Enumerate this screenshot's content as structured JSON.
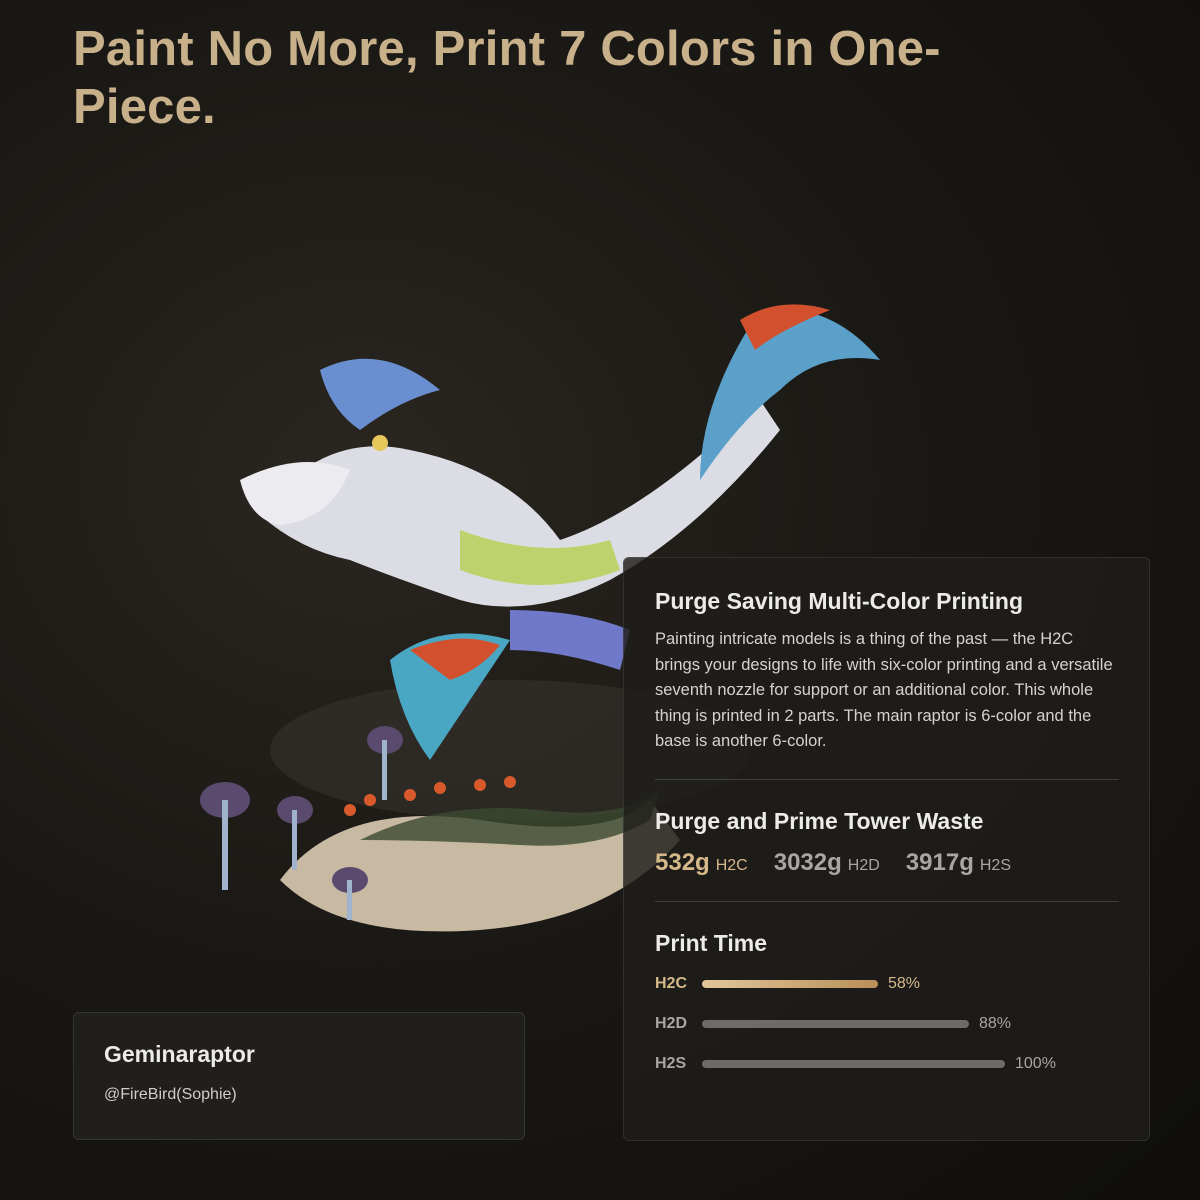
{
  "headline": "Paint No More, Print 7 Colors in One-Piece.",
  "model_card": {
    "name": "Geminaraptor",
    "credit": "@FireBird(Sophie)"
  },
  "info_card": {
    "title": "Purge Saving Multi-Color Printing",
    "body": "Painting intricate models is a thing of the past — the H2C brings your designs to life with six-color printing and a versatile seventh nozzle for support or an additional color. This whole thing is printed in 2 parts. The main raptor is 6-color and the base is another 6-color.",
    "waste": {
      "title": "Purge and Prime Tower Waste",
      "items": [
        {
          "value": "532g",
          "model": "H2C"
        },
        {
          "value": "3032g",
          "model": "H2D"
        },
        {
          "value": "3917g",
          "model": "H2S"
        }
      ]
    },
    "print_time": {
      "title": "Print Time",
      "bars": [
        {
          "model": "H2C",
          "label": "58%",
          "fraction": 0.58
        },
        {
          "model": "H2D",
          "label": "88%",
          "fraction": 0.88
        },
        {
          "model": "H2S",
          "label": "100%",
          "fraction": 1.0
        }
      ]
    }
  },
  "colors": {
    "accent_gold": "#d6b98a",
    "headline_gold": "#c7b08a",
    "muted_gray": "#a9a6a1"
  }
}
